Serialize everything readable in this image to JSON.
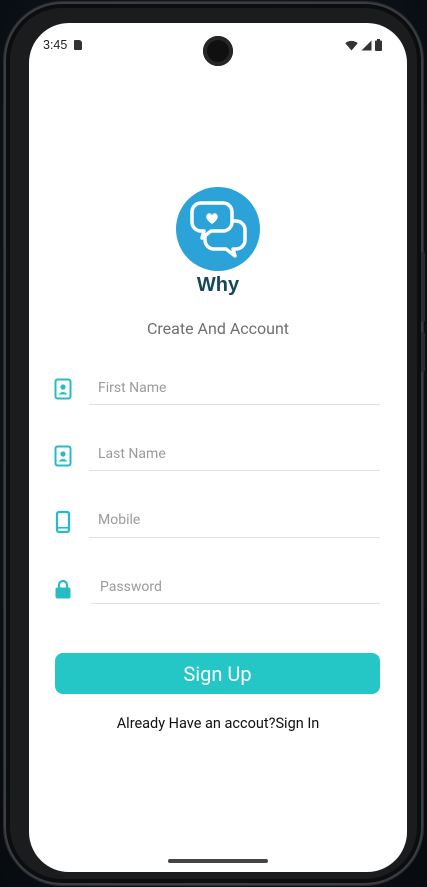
{
  "status_bar": {
    "time": "3:45"
  },
  "app": {
    "name": "Why",
    "subtitle": "Create And Account"
  },
  "form": {
    "first_name": {
      "placeholder": "First Name",
      "value": ""
    },
    "last_name": {
      "placeholder": "Last Name",
      "value": ""
    },
    "mobile": {
      "placeholder": "Mobile",
      "value": ""
    },
    "password": {
      "placeholder": "Password",
      "value": ""
    }
  },
  "signup_button": {
    "label": "Sign Up"
  },
  "footer": {
    "signin_text": "Already Have an accout?Sign In"
  },
  "colors": {
    "accent": "#25c6c6",
    "icon_teal": "#26bcc6",
    "logo_blue": "#2ba3d9",
    "brand_text": "#17475a"
  },
  "icons": {
    "first_name": "contact-card-icon",
    "last_name": "contact-card-icon",
    "mobile": "phone-icon",
    "password": "lock-icon"
  }
}
